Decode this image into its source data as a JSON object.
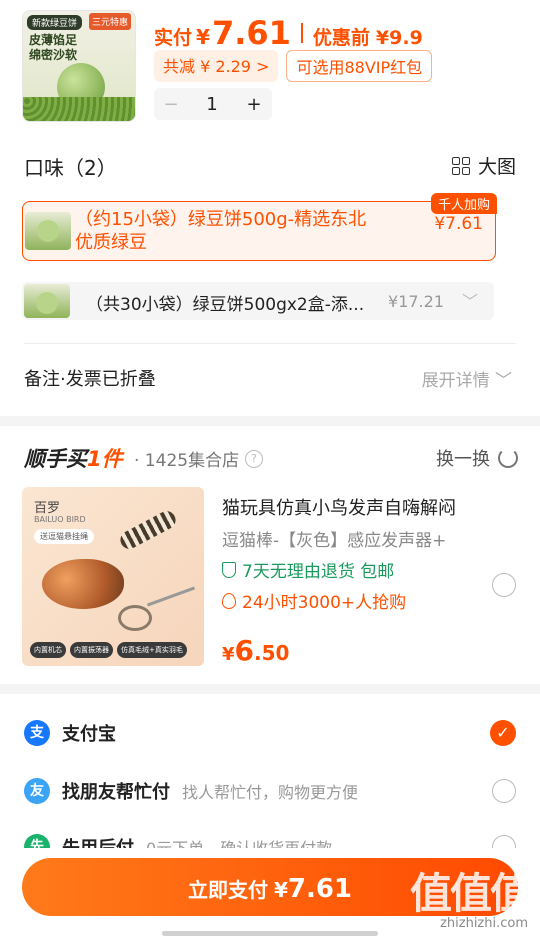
{
  "product": {
    "image_tag": "新款绿豆饼",
    "image_text": "皮薄馅足\n绵密沙软",
    "image_badge": "三元特惠",
    "price_label": "实付",
    "currency": "¥",
    "price": "7.61",
    "pre_label": "优惠前",
    "pre_price": "¥9.9",
    "discount_chip": "共减 ¥ 2.29 >",
    "vip_chip": "可选用88VIP红包",
    "qty_minus": "−",
    "quantity": "1",
    "qty_plus": "+"
  },
  "flavor": {
    "title": "口味（2）",
    "view_label": "大图",
    "options": [
      {
        "name": "（约15小袋）绿豆饼500g-精选东北优质绿豆",
        "price": "¥7.61",
        "badge": "千人加购",
        "selected": true
      },
      {
        "name": "（共30小袋）绿豆饼500gx2盒-添...",
        "price": "¥17.21",
        "selected": false
      }
    ]
  },
  "note": {
    "label": "备注·发票已折叠",
    "action": "展开详情 ﹀"
  },
  "buy_along": {
    "title_prefix": "顺手买",
    "title_suffix": "1件",
    "store": "· 1425集合店",
    "help": "?",
    "swap": "换一换",
    "product": {
      "brand": "百罗",
      "brand_en": "BAILUO BIRD",
      "pill": "送逗猫悬挂绳",
      "feature_icons": [
        "内置机芯",
        "内置振荡器",
        "仿真毛绒+真实羽毛"
      ],
      "title": "猫玩具仿真小鸟发声自嗨解闷",
      "subtitle": "逗猫棒-【灰色】感应发声器+",
      "returns": "7天无理由退货 包邮",
      "hot": "24小时3000+人抢购",
      "price_currency": "¥",
      "price_int": "6",
      "price_dec": ".50"
    }
  },
  "payments": [
    {
      "name": "支付宝",
      "desc": "",
      "icon": "支",
      "color": "#1677ff",
      "selected": true
    },
    {
      "name": "找朋友帮忙付",
      "desc": "找人帮忙付，购物更方便",
      "icon": "友",
      "color": "#3ba4f5",
      "selected": false
    },
    {
      "name": "先用后付",
      "desc": "0元下单，确认收货再付款",
      "icon": "先",
      "color": "#19b36b",
      "selected": false
    }
  ],
  "pay_button": {
    "label": "立即支付",
    "currency": "¥",
    "amount": "7.61"
  },
  "watermark": {
    "big": "值值值",
    "small": "zhizhizhi.com"
  },
  "colors": {
    "accent": "#ff5000",
    "green": "#1a9b5e"
  }
}
